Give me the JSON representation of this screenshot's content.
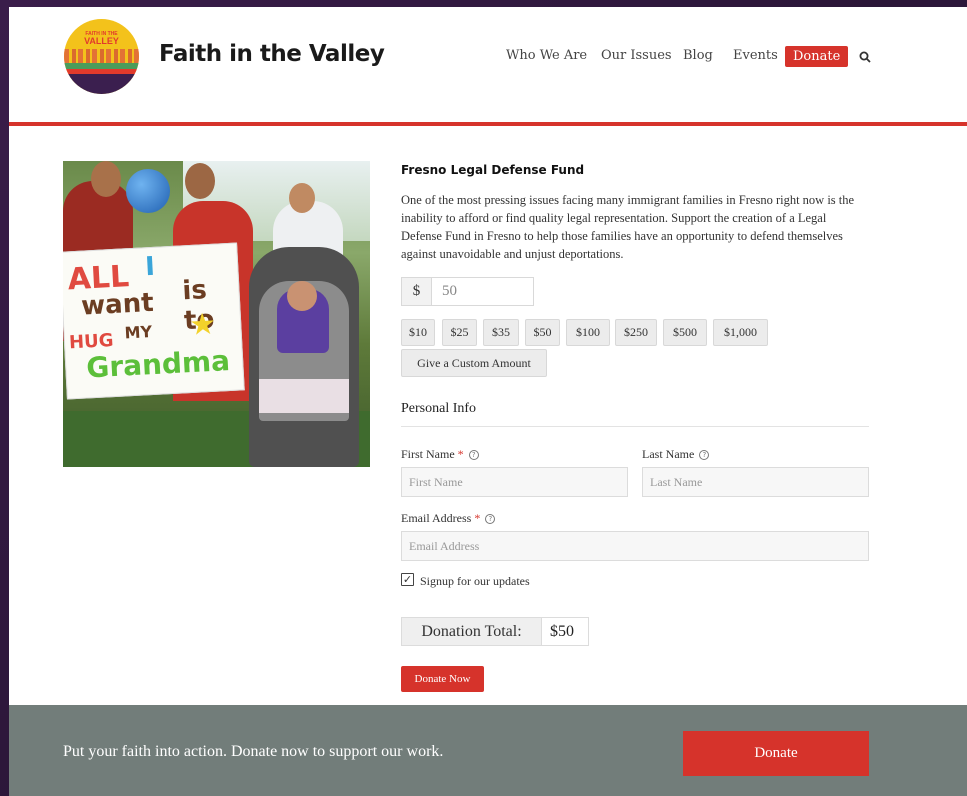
{
  "header": {
    "logo": {
      "top_text": "FAITH IN THE",
      "main_text": "VALLEY"
    },
    "brand": "Faith in the Valley",
    "nav": [
      "Who We Are",
      "Our Issues",
      "Blog",
      "Events"
    ],
    "donate_label": "Donate",
    "search_icon": "search-icon"
  },
  "photo": {
    "sign_lines": [
      "ALL",
      "I",
      "want",
      "is to",
      "HUG",
      "MY",
      "Grandma"
    ]
  },
  "form": {
    "title": "Fresno Legal Defense Fund",
    "description": "One of the most pressing issues facing many immigrant families in Fresno right now is the inability to afford or find quality legal representation. Support the creation of a Legal Defense Fund in Fresno to help those families have an opportunity to defend themselves against unavoidable and unjust deportations.",
    "currency_symbol": "$",
    "amount_value": "50",
    "levels": [
      "$10",
      "$25",
      "$35",
      "$50",
      "$100",
      "$250",
      "$500",
      "$1,000"
    ],
    "custom_amount_label": "Give a Custom Amount",
    "personal_info_title": "Personal Info",
    "first_name_label": "First Name",
    "first_name_placeholder": "First Name",
    "last_name_label": "Last Name",
    "last_name_placeholder": "Last Name",
    "email_label": "Email Address",
    "email_placeholder": "Email Address",
    "required_mark": "*",
    "help_glyph": "?",
    "signup_label": "Signup for our updates",
    "signup_checked": true,
    "checkmark": "✓",
    "total_label": "Donation Total:",
    "total_value": "$50",
    "donate_now_label": "Donate Now"
  },
  "footer": {
    "text": "Put your faith into action. Donate now to support our work.",
    "donate_label": "Donate"
  },
  "colors": {
    "accent": "#d6332b",
    "footer_bg": "#727d7a",
    "outer_bg": "#3a1d4a"
  }
}
